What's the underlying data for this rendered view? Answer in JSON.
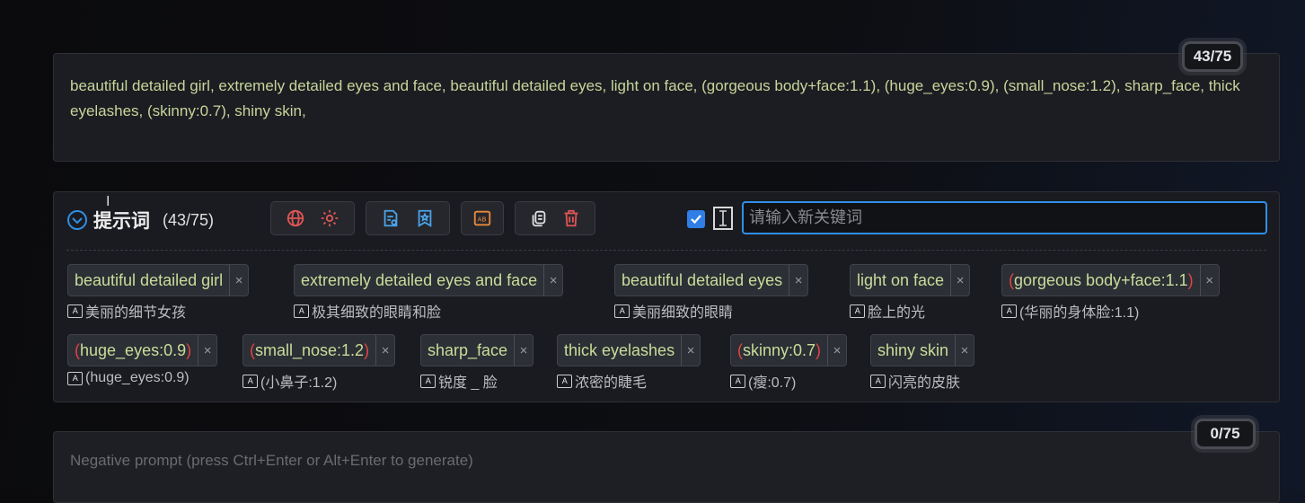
{
  "prompt": {
    "text": "beautiful detailed girl, extremely detailed eyes and face, beautiful detailed eyes, light on face, (gorgeous body+face:1.1), (huge_eyes:0.9), (small_nose:1.2), sharp_face, thick eyelashes, (skinny:0.7), shiny skin,",
    "counter": "43/75"
  },
  "tag_panel": {
    "title": "提示词",
    "count": "(43/75)",
    "keyword_placeholder": "请输入新关键词",
    "checkbox_checked": true,
    "buttons": [
      "globe-icon",
      "gear-icon",
      "doc-settings-icon",
      "bookmark-star-icon",
      "translate-icon",
      "copy-icon",
      "trash-icon"
    ],
    "tags": [
      {
        "label": "beautiful detailed girl",
        "translation": "美丽的细节女孩",
        "weighted": false
      },
      {
        "label": "extremely detailed eyes and face",
        "translation": "极其细致的眼睛和脸",
        "weighted": false
      },
      {
        "label": "beautiful detailed eyes",
        "translation": "美丽细致的眼睛",
        "weighted": false
      },
      {
        "label": "light on face",
        "translation": "脸上的光",
        "weighted": false
      },
      {
        "label": "gorgeous body+face:1.1",
        "translation": "(华丽的身体脸:1.1)",
        "weighted": true
      },
      {
        "label": "huge_eyes:0.9",
        "translation": "(huge_eyes:0.9)",
        "weighted": true
      },
      {
        "label": "small_nose:1.2",
        "translation": "(小鼻子:1.2)",
        "weighted": true
      },
      {
        "label": "sharp_face",
        "translation": "锐度 _ 脸",
        "weighted": false
      },
      {
        "label": "thick eyelashes",
        "translation": "浓密的睫毛",
        "weighted": false
      },
      {
        "label": "skinny:0.7",
        "translation": "(瘦:0.7)",
        "weighted": true
      },
      {
        "label": "shiny skin",
        "translation": "闪亮的皮肤",
        "weighted": false
      }
    ],
    "translate_badge": "A",
    "close_glyph": "×",
    "paren_open": "(",
    "paren_close": ")"
  },
  "negative": {
    "placeholder": "Negative prompt (press Ctrl+Enter or Alt+Enter to generate)",
    "counter": "0/75"
  },
  "colors": {
    "tag_text": "#c9dc9a",
    "paren": "#e04545",
    "accent_blue": "#2f8fe6",
    "icon_red": "#e05555",
    "icon_blue": "#4aa3e8",
    "icon_orange": "#e88a3a"
  }
}
